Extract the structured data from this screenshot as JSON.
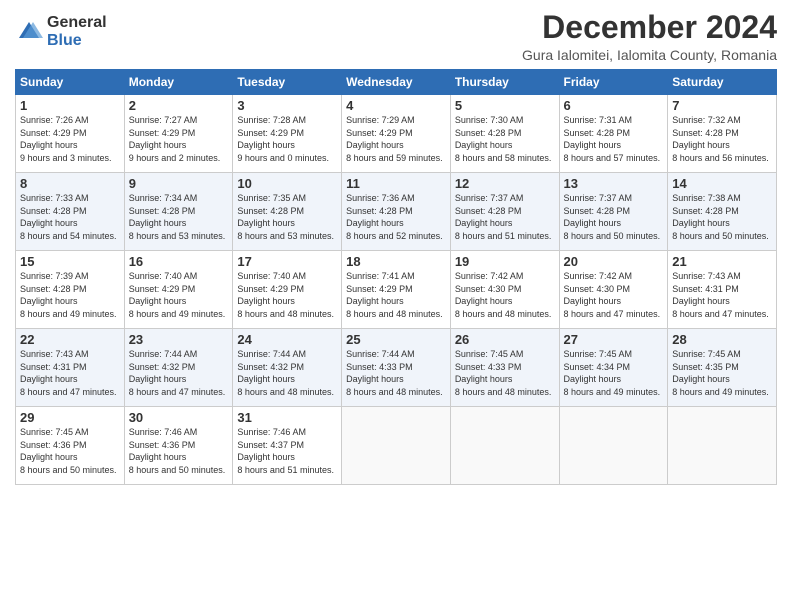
{
  "logo": {
    "general": "General",
    "blue": "Blue"
  },
  "title": "December 2024",
  "subtitle": "Gura Ialomitei, Ialomita County, Romania",
  "weekdays": [
    "Sunday",
    "Monday",
    "Tuesday",
    "Wednesday",
    "Thursday",
    "Friday",
    "Saturday"
  ],
  "weeks": [
    [
      {
        "day": "1",
        "sunrise": "7:26 AM",
        "sunset": "4:29 PM",
        "daylight": "9 hours and 3 minutes."
      },
      {
        "day": "2",
        "sunrise": "7:27 AM",
        "sunset": "4:29 PM",
        "daylight": "9 hours and 2 minutes."
      },
      {
        "day": "3",
        "sunrise": "7:28 AM",
        "sunset": "4:29 PM",
        "daylight": "9 hours and 0 minutes."
      },
      {
        "day": "4",
        "sunrise": "7:29 AM",
        "sunset": "4:29 PM",
        "daylight": "8 hours and 59 minutes."
      },
      {
        "day": "5",
        "sunrise": "7:30 AM",
        "sunset": "4:28 PM",
        "daylight": "8 hours and 58 minutes."
      },
      {
        "day": "6",
        "sunrise": "7:31 AM",
        "sunset": "4:28 PM",
        "daylight": "8 hours and 57 minutes."
      },
      {
        "day": "7",
        "sunrise": "7:32 AM",
        "sunset": "4:28 PM",
        "daylight": "8 hours and 56 minutes."
      }
    ],
    [
      {
        "day": "8",
        "sunrise": "7:33 AM",
        "sunset": "4:28 PM",
        "daylight": "8 hours and 54 minutes."
      },
      {
        "day": "9",
        "sunrise": "7:34 AM",
        "sunset": "4:28 PM",
        "daylight": "8 hours and 53 minutes."
      },
      {
        "day": "10",
        "sunrise": "7:35 AM",
        "sunset": "4:28 PM",
        "daylight": "8 hours and 53 minutes."
      },
      {
        "day": "11",
        "sunrise": "7:36 AM",
        "sunset": "4:28 PM",
        "daylight": "8 hours and 52 minutes."
      },
      {
        "day": "12",
        "sunrise": "7:37 AM",
        "sunset": "4:28 PM",
        "daylight": "8 hours and 51 minutes."
      },
      {
        "day": "13",
        "sunrise": "7:37 AM",
        "sunset": "4:28 PM",
        "daylight": "8 hours and 50 minutes."
      },
      {
        "day": "14",
        "sunrise": "7:38 AM",
        "sunset": "4:28 PM",
        "daylight": "8 hours and 50 minutes."
      }
    ],
    [
      {
        "day": "15",
        "sunrise": "7:39 AM",
        "sunset": "4:28 PM",
        "daylight": "8 hours and 49 minutes."
      },
      {
        "day": "16",
        "sunrise": "7:40 AM",
        "sunset": "4:29 PM",
        "daylight": "8 hours and 49 minutes."
      },
      {
        "day": "17",
        "sunrise": "7:40 AM",
        "sunset": "4:29 PM",
        "daylight": "8 hours and 48 minutes."
      },
      {
        "day": "18",
        "sunrise": "7:41 AM",
        "sunset": "4:29 PM",
        "daylight": "8 hours and 48 minutes."
      },
      {
        "day": "19",
        "sunrise": "7:42 AM",
        "sunset": "4:30 PM",
        "daylight": "8 hours and 48 minutes."
      },
      {
        "day": "20",
        "sunrise": "7:42 AM",
        "sunset": "4:30 PM",
        "daylight": "8 hours and 47 minutes."
      },
      {
        "day": "21",
        "sunrise": "7:43 AM",
        "sunset": "4:31 PM",
        "daylight": "8 hours and 47 minutes."
      }
    ],
    [
      {
        "day": "22",
        "sunrise": "7:43 AM",
        "sunset": "4:31 PM",
        "daylight": "8 hours and 47 minutes."
      },
      {
        "day": "23",
        "sunrise": "7:44 AM",
        "sunset": "4:32 PM",
        "daylight": "8 hours and 47 minutes."
      },
      {
        "day": "24",
        "sunrise": "7:44 AM",
        "sunset": "4:32 PM",
        "daylight": "8 hours and 48 minutes."
      },
      {
        "day": "25",
        "sunrise": "7:44 AM",
        "sunset": "4:33 PM",
        "daylight": "8 hours and 48 minutes."
      },
      {
        "day": "26",
        "sunrise": "7:45 AM",
        "sunset": "4:33 PM",
        "daylight": "8 hours and 48 minutes."
      },
      {
        "day": "27",
        "sunrise": "7:45 AM",
        "sunset": "4:34 PM",
        "daylight": "8 hours and 49 minutes."
      },
      {
        "day": "28",
        "sunrise": "7:45 AM",
        "sunset": "4:35 PM",
        "daylight": "8 hours and 49 minutes."
      }
    ],
    [
      {
        "day": "29",
        "sunrise": "7:45 AM",
        "sunset": "4:36 PM",
        "daylight": "8 hours and 50 minutes."
      },
      {
        "day": "30",
        "sunrise": "7:46 AM",
        "sunset": "4:36 PM",
        "daylight": "8 hours and 50 minutes."
      },
      {
        "day": "31",
        "sunrise": "7:46 AM",
        "sunset": "4:37 PM",
        "daylight": "8 hours and 51 minutes."
      },
      null,
      null,
      null,
      null
    ]
  ],
  "labels": {
    "sunrise": "Sunrise:",
    "sunset": "Sunset:",
    "daylight": "Daylight hours"
  }
}
